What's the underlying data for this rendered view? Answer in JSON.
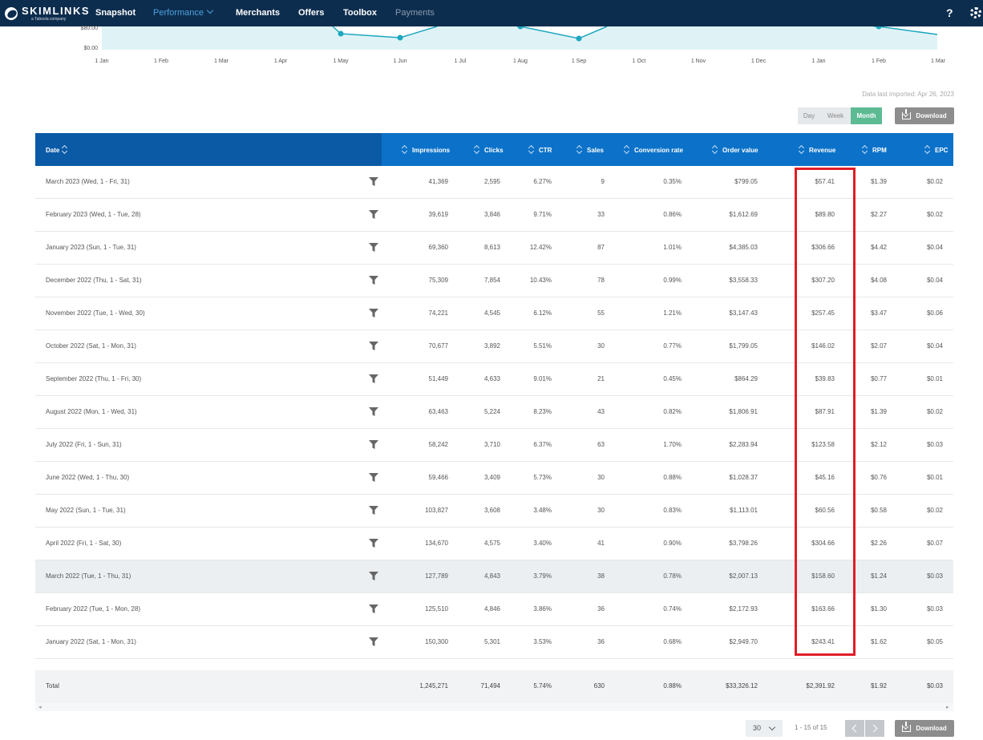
{
  "nav": {
    "logo": "SKIMLINKS",
    "logo_sub": "a Taboola company",
    "items": [
      "Snapshot",
      "Performance",
      "Merchants",
      "Offers",
      "Toolbox",
      "Payments"
    ],
    "help": "?"
  },
  "chart": {
    "y_labels": [
      "$80.00",
      "$0.00"
    ],
    "x_labels": [
      "1 Jan",
      "1 Feb",
      "1 Mar",
      "1 Apr",
      "1 May",
      "1 Jun",
      "1 Jul",
      "1 Aug",
      "1 Sep",
      "1 Oct",
      "1 Nov",
      "1 Dec",
      "1 Jan",
      "1 Feb",
      "1 Mar"
    ]
  },
  "data_imported": "Data last imported: Apr 26, 2023",
  "granularity": {
    "day": "Day",
    "week": "Week",
    "month": "Month",
    "selected": "Month"
  },
  "download_label": "Download",
  "columns": [
    "Date",
    "Impressions",
    "Clicks",
    "CTR",
    "Sales",
    "Conversion rate",
    "Order value",
    "Revenue",
    "RPM",
    "EPC"
  ],
  "rows": [
    [
      "March 2023 (Wed, 1 - Fri, 31)",
      "41,369",
      "2,595",
      "6.27%",
      "9",
      "0.35%",
      "$799.05",
      "$57.41",
      "$1.39",
      "$0.02"
    ],
    [
      "February 2023 (Wed, 1 - Tue, 28)",
      "39,619",
      "3,846",
      "9.71%",
      "33",
      "0.86%",
      "$1,612.69",
      "$89.80",
      "$2.27",
      "$0.02"
    ],
    [
      "January 2023 (Sun, 1 - Tue, 31)",
      "69,360",
      "8,613",
      "12.42%",
      "87",
      "1.01%",
      "$4,385.03",
      "$306.66",
      "$4.42",
      "$0.04"
    ],
    [
      "December 2022 (Thu, 1 - Sat, 31)",
      "75,309",
      "7,854",
      "10.43%",
      "78",
      "0.99%",
      "$3,558.33",
      "$307.20",
      "$4.08",
      "$0.04"
    ],
    [
      "November 2022 (Tue, 1 - Wed, 30)",
      "74,221",
      "4,545",
      "6.12%",
      "55",
      "1.21%",
      "$3,147.43",
      "$257.45",
      "$3.47",
      "$0.06"
    ],
    [
      "October 2022 (Sat, 1 - Mon, 31)",
      "70,677",
      "3,892",
      "5.51%",
      "30",
      "0.77%",
      "$1,799.05",
      "$146.02",
      "$2.07",
      "$0.04"
    ],
    [
      "September 2022 (Thu, 1 - Fri, 30)",
      "51,449",
      "4,633",
      "9.01%",
      "21",
      "0.45%",
      "$864.29",
      "$39.83",
      "$0.77",
      "$0.01"
    ],
    [
      "August 2022 (Mon, 1 - Wed, 31)",
      "63,463",
      "5,224",
      "8.23%",
      "43",
      "0.82%",
      "$1,806.91",
      "$87.91",
      "$1.39",
      "$0.02"
    ],
    [
      "July 2022 (Fri, 1 - Sun, 31)",
      "58,242",
      "3,710",
      "6.37%",
      "63",
      "1.70%",
      "$2,283.94",
      "$123.58",
      "$2.12",
      "$0.03"
    ],
    [
      "June 2022 (Wed, 1 - Thu, 30)",
      "59,466",
      "3,409",
      "5.73%",
      "30",
      "0.88%",
      "$1,028.37",
      "$45.16",
      "$0.76",
      "$0.01"
    ],
    [
      "May 2022 (Sun, 1 - Tue, 31)",
      "103,827",
      "3,608",
      "3.48%",
      "30",
      "0.83%",
      "$1,113.01",
      "$60.56",
      "$0.58",
      "$0.02"
    ],
    [
      "April 2022 (Fri, 1 - Sat, 30)",
      "134,670",
      "4,575",
      "3.40%",
      "41",
      "0.90%",
      "$3,798.26",
      "$304.66",
      "$2.26",
      "$0.07"
    ],
    [
      "March 2022 (Tue, 1 - Thu, 31)",
      "127,789",
      "4,843",
      "3.79%",
      "38",
      "0.78%",
      "$2,007.13",
      "$158.60",
      "$1.24",
      "$0.03"
    ],
    [
      "February 2022 (Tue, 1 - Mon, 28)",
      "125,510",
      "4,846",
      "3.86%",
      "36",
      "0.74%",
      "$2,172.93",
      "$163.66",
      "$1.30",
      "$0.03"
    ],
    [
      "January 2022 (Sat, 1 - Mon, 31)",
      "150,300",
      "5,301",
      "3.53%",
      "36",
      "0.68%",
      "$2,949.70",
      "$243.41",
      "$1.62",
      "$0.05"
    ]
  ],
  "highlighted_row": "March 2022 (Tue, 1 - Thu, 31)",
  "total": [
    "Total",
    "1,245,271",
    "71,494",
    "5.74%",
    "630",
    "0.88%",
    "$33,326.12",
    "$2,391.92",
    "$1.92",
    "$0.03"
  ],
  "pagination": {
    "per_page": "30",
    "range": "1 - 15 of 15"
  },
  "colors": {
    "nav_bg": "#0d2d4e",
    "header_bg": "#0c72c9",
    "date_header_bg": "#0b5aa6",
    "chart_line": "#1ea7c0",
    "chart_fill": "#dff3f6",
    "active_toggle": "#5dbb94",
    "annotation": "#e01e26"
  }
}
